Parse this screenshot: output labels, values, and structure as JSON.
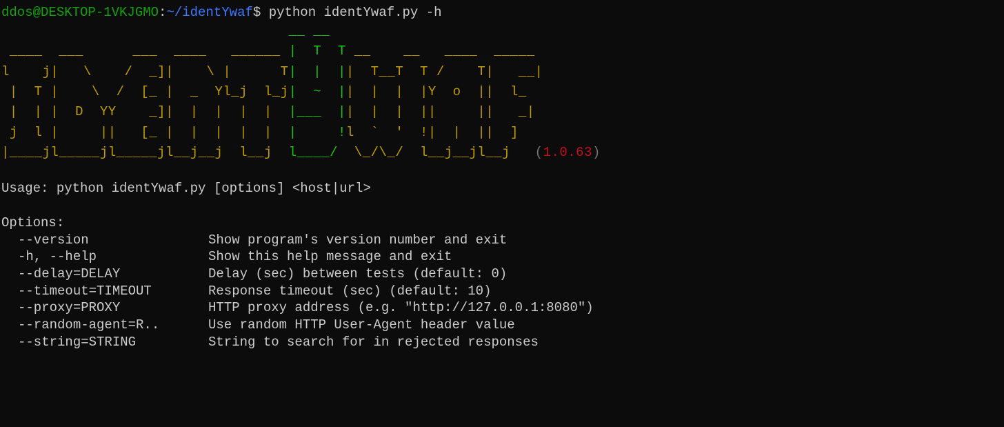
{
  "prompt": {
    "user": "ddos",
    "at": "@",
    "host": "DESKTOP-1VKJGMO",
    "colon": ":",
    "path": "~/identYwaf",
    "dollar": "$ ",
    "command": "python identYwaf.py -h"
  },
  "ascii": {
    "line1a": "                                   ",
    "line1b": "__ __ ",
    "line2a": " ____  ___      ___  ____   ______ ",
    "line2b": "|  T  T",
    "line2c": " __    __   ____  _____ ",
    "line3a": "l    j|   \\    /  _]|    \\ |      T",
    "line3b": "|  |  |",
    "line3c": "|  T__T  T /    T|   __|",
    "line4a": " |  T |    \\  /  [_ |  _  Yl_j  l_j",
    "line4b": "|  ~  |",
    "line4c": "|  |  |  |Y  o  ||  l_  ",
    "line5a": " |  | |  D  YY    _]|  |  |  |  |  ",
    "line5b": "|___  |",
    "line5c": "|  |  |  ||     ||   _| ",
    "line6a": " j  l |     ||   [_ |  |  |  |  |  ",
    "line6b": "|     !",
    "line6c": "l  `  '  !|  |  ||  ]   ",
    "line7a": "|____jl_____jl_____jl__j__j  l__j  ",
    "line7b": "l____/ ",
    "line7c": " \\_/\\_/  l__j__jl__j  ",
    "version_paren_open": " (",
    "version": "1.0.63",
    "version_paren_close": ")"
  },
  "usage": {
    "line": "Usage: python identYwaf.py [options] <host|url>"
  },
  "options": {
    "header": "Options:",
    "rows": [
      {
        "flag": "--version",
        "desc": "Show program's version number and exit"
      },
      {
        "flag": "-h, --help",
        "desc": "Show this help message and exit"
      },
      {
        "flag": "--delay=DELAY",
        "desc": "Delay (sec) between tests (default: 0)"
      },
      {
        "flag": "--timeout=TIMEOUT",
        "desc": "Response timeout (sec) (default: 10)"
      },
      {
        "flag": "--proxy=PROXY",
        "desc": "HTTP proxy address (e.g. \"http://127.0.0.1:8080\")"
      },
      {
        "flag": "--random-agent=R..",
        "desc": "Use random HTTP User-Agent header value"
      },
      {
        "flag": "--string=STRING",
        "desc": "String to search for in rejected responses"
      }
    ]
  }
}
